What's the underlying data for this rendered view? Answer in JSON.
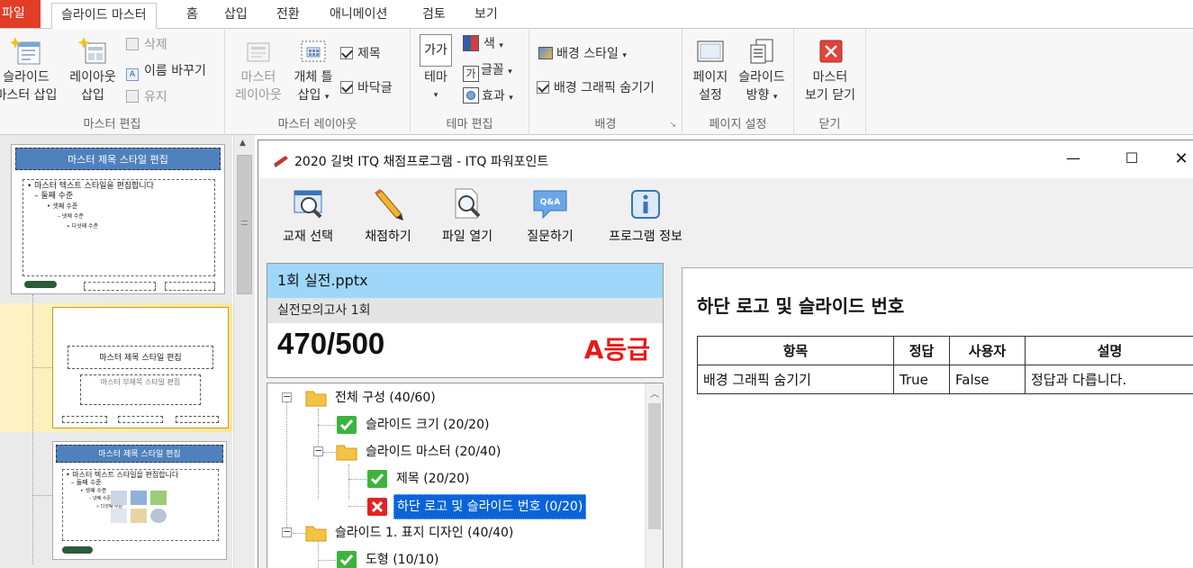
{
  "ribbon": {
    "tabs": [
      {
        "label": "파일"
      },
      {
        "label": "슬라이드 마스터"
      },
      {
        "label": "홈"
      },
      {
        "label": "삽입"
      },
      {
        "label": "전환"
      },
      {
        "label": "애니메이션"
      },
      {
        "label": "검토"
      },
      {
        "label": "보기"
      }
    ],
    "groups": {
      "master_edit": {
        "label": "마스터 편집",
        "insert_slide_master": [
          "슬라이드",
          "마스터 삽입"
        ],
        "insert_layout": [
          "레이아웃",
          "삽입"
        ],
        "delete": "삭제",
        "rename": "이름 바꾸기",
        "preserve": "유지"
      },
      "master_layout": {
        "label": "마스터 레이아웃",
        "master_layout_btn": [
          "마스터",
          "레이아웃"
        ],
        "insert_placeholder": [
          "개체 틀",
          "삽입"
        ],
        "title_check": "제목",
        "footer_check": "바닥글"
      },
      "theme_edit": {
        "label": "테마 편집",
        "themes": "테마",
        "colors": "색",
        "fonts": "글꼴",
        "effects": "효과",
        "theme_glyph": "가가",
        "font_glyph": "가"
      },
      "background": {
        "label": "배경",
        "background_styles": "배경 스타일",
        "hide_background_graphics": "배경 그래픽 숨기기"
      },
      "page_setup": {
        "label": "페이지 설정",
        "page_setup_btn": [
          "페이지",
          "설정"
        ],
        "slide_orientation": [
          "슬라이드",
          "방향"
        ]
      },
      "close": {
        "label": "닫기",
        "close_master_view": [
          "마스터",
          "보기 닫기"
        ]
      }
    }
  },
  "slides": {
    "slide1": {
      "title": "마스터 제목 스타일 편집",
      "body": [
        "• 마스터 텍스트 스타일을 편집합니다",
        "– 둘째 수준",
        "• 셋째 수준",
        "– 넷째 수준",
        "» 다섯째 수준"
      ]
    },
    "slide2": {
      "title": "마스터 제목 스타일 편집",
      "subtitle": "마스터 부제목 스타일 편집"
    },
    "slide3": {
      "title": "마스터 제목 스타일 편집",
      "body": [
        "• 마스터 텍스트 스타일을 편집합니다",
        "– 둘째 수준",
        "• 셋째 수준",
        "– 넷째 수준",
        "» 다섯째 수준"
      ]
    }
  },
  "dialog": {
    "title": "2020 길벗 ITQ 채점프로그램 - ITQ 파워포인트",
    "toolbar": [
      {
        "label": "교재 선택",
        "icon": "book-search-icon"
      },
      {
        "label": "채점하기",
        "icon": "pencil-icon"
      },
      {
        "label": "파일 열기",
        "icon": "file-magnifier-icon"
      },
      {
        "label": "질문하기",
        "icon": "qa-bubble-icon"
      },
      {
        "label": "프로그램 정보",
        "icon": "info-icon"
      }
    ],
    "qa_badge": "Q&A",
    "file_name": "1회 실전.pptx",
    "exam_name": "실전모의고사 1회",
    "score": "470/500",
    "grade": "A등급",
    "tree": [
      {
        "label": "전체 구성 (40/60)",
        "type": "folder"
      },
      {
        "label": "슬라이드 크기 (20/20)",
        "type": "pass"
      },
      {
        "label": "슬라이드 마스터 (20/40)",
        "type": "folder"
      },
      {
        "label": "제목 (20/20)",
        "type": "pass"
      },
      {
        "label": "하단 로고 및 슬라이드 번호 (0/20)",
        "type": "fail"
      },
      {
        "label": "슬라이드 1. 표지 디자인 (40/40)",
        "type": "folder"
      },
      {
        "label": "도형 (10/10)",
        "type": "pass"
      }
    ],
    "detail": {
      "title": "하단 로고 및 슬라이드 번호",
      "headers": [
        "항목",
        "정답",
        "사용자",
        "설명"
      ],
      "rows": [
        [
          "배경 그래픽 숨기기",
          "True",
          "False",
          "정답과 다릅니다."
        ]
      ]
    }
  }
}
